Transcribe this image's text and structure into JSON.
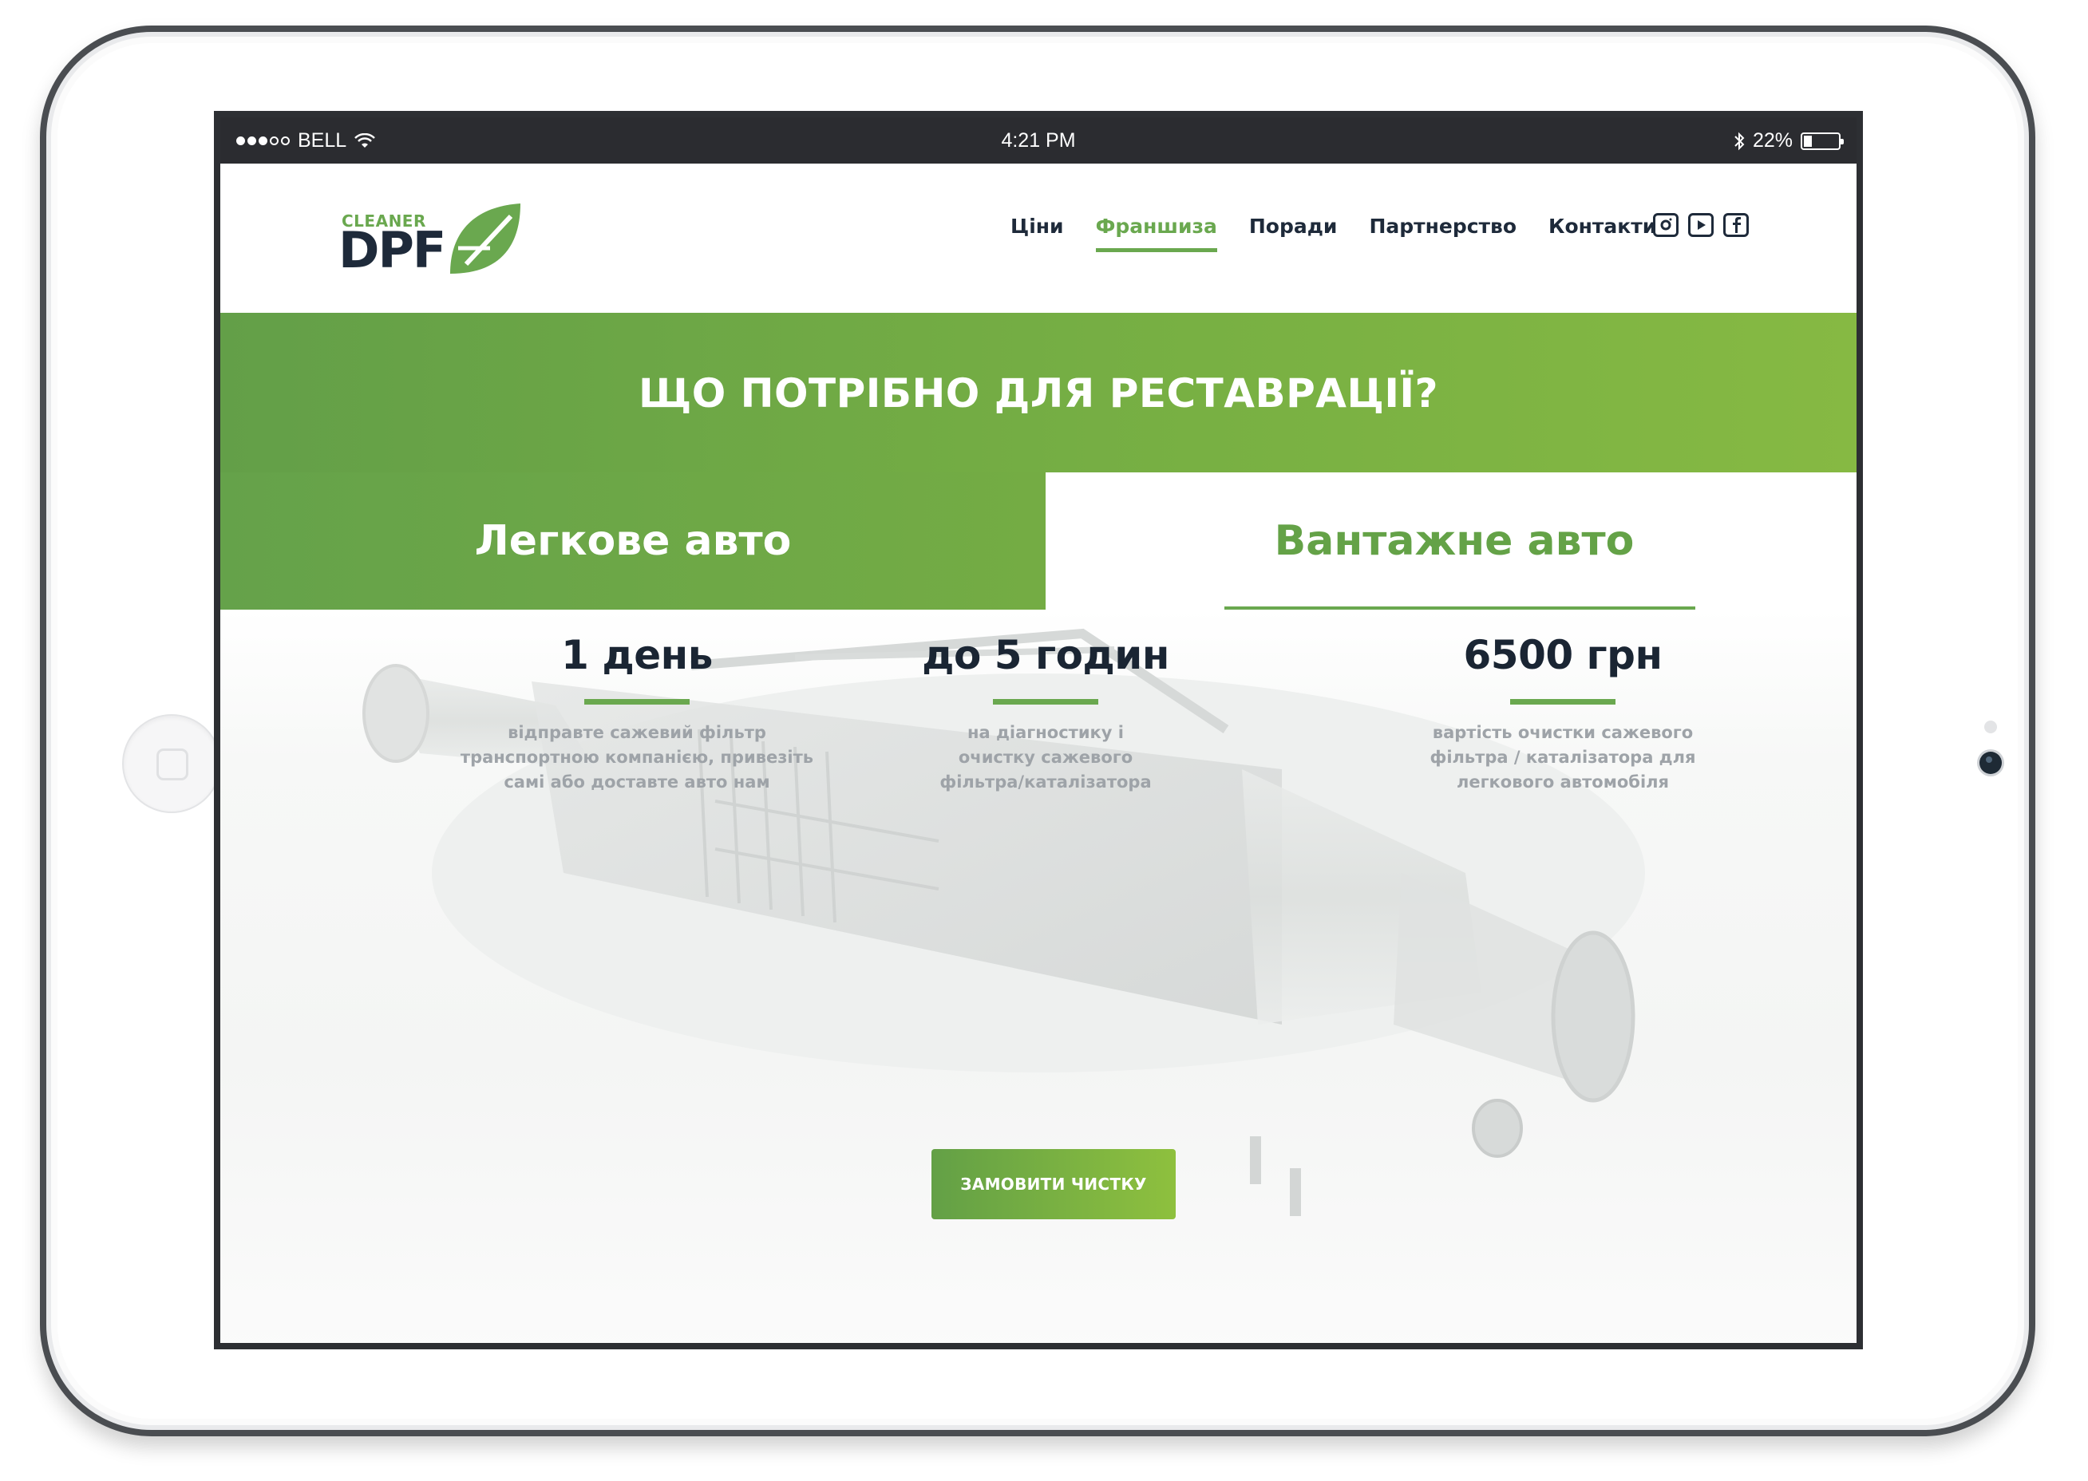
{
  "statusbar": {
    "carrier": "BELL",
    "time": "4:21 PM",
    "battery": "22%"
  },
  "logo": {
    "small": "CLEANER",
    "big": "DPF"
  },
  "nav": {
    "items": [
      {
        "label": "Ціни"
      },
      {
        "label": "Франшиза"
      },
      {
        "label": "Поради"
      },
      {
        "label": "Партнерство"
      },
      {
        "label": "Контакти"
      }
    ],
    "active": "Франшиза"
  },
  "social": {
    "icons": [
      "instagram-icon",
      "youtube-icon",
      "facebook-icon"
    ]
  },
  "hero": {
    "title": "ЩО ПОТРІБНО ДЛЯ РЕСТАВРАЦІЇ?"
  },
  "tabs": {
    "car": "Легкове авто",
    "truck": "Вантажне авто",
    "selected": "Вантажне авто"
  },
  "stats": [
    {
      "value": "1 день",
      "desc": [
        "відправте сажевий фільтр",
        "транспортною компанією, привезіть",
        "самі або доставте авто нам"
      ]
    },
    {
      "value": "до 5 годин",
      "desc": [
        "на діагностику і",
        "очистку сажевого",
        "фільтра/каталізатора"
      ]
    },
    {
      "value": "6500 грн",
      "desc": [
        "вартість очистки сажевого",
        "фільтра / каталізатора для",
        "легкового автомобіля"
      ]
    }
  ],
  "cta": {
    "label": "ЗАМОВИТИ ЧИСТКУ"
  },
  "colors": {
    "accent": "#6aa84f",
    "dark": "#1e2a3a",
    "statusbar": "#2b2c30"
  }
}
